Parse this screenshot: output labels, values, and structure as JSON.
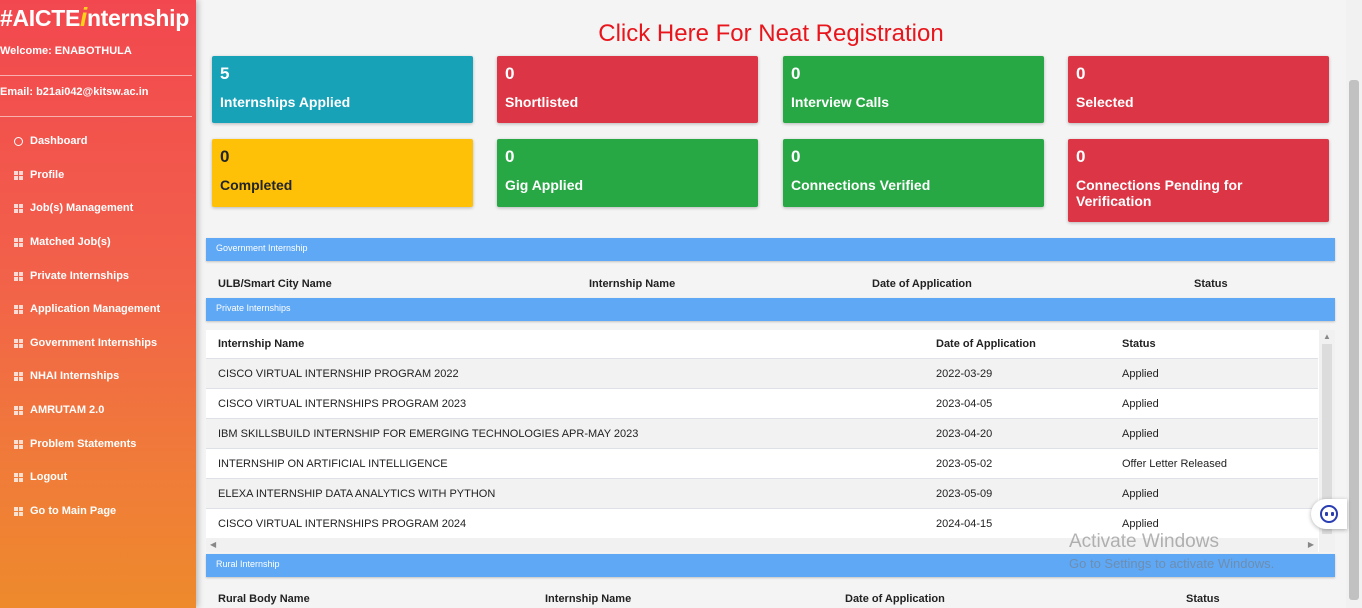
{
  "sidebar": {
    "logo_prefix": "#AICTE",
    "logo_i": "i",
    "logo_suffix": "nternship",
    "welcome": "Welcome: ENABOTHULA",
    "email": "Email: b21ai042@kitsw.ac.in",
    "items": [
      {
        "label": "Dashboard",
        "icon": "circle-icon"
      },
      {
        "label": "Profile",
        "icon": "grid-icon"
      },
      {
        "label": "Job(s) Management",
        "icon": "grid-icon"
      },
      {
        "label": "Matched Job(s)",
        "icon": "grid-icon"
      },
      {
        "label": "Private Internships",
        "icon": "grid-icon"
      },
      {
        "label": "Application Management",
        "icon": "grid-icon"
      },
      {
        "label": "Government Internships",
        "icon": "grid-icon"
      },
      {
        "label": "NHAI Internships",
        "icon": "grid-icon"
      },
      {
        "label": "AMRUTAM 2.0",
        "icon": "grid-icon"
      },
      {
        "label": "Problem Statements",
        "icon": "grid-icon"
      },
      {
        "label": "Logout",
        "icon": "grid-icon"
      },
      {
        "label": "Go to Main Page",
        "icon": "grid-icon"
      }
    ]
  },
  "header": {
    "neat_link": "Click Here For Neat Registration"
  },
  "cards": [
    {
      "value": "5",
      "label": "Internships Applied",
      "color": "#17a2b8"
    },
    {
      "value": "0",
      "label": "Shortlisted",
      "color": "#dc3545"
    },
    {
      "value": "0",
      "label": "Interview Calls",
      "color": "#28a745"
    },
    {
      "value": "0",
      "label": "Selected",
      "color": "#dc3545"
    },
    {
      "value": "0",
      "label": "Completed",
      "color": "#ffc107"
    },
    {
      "value": "0",
      "label": "Gig Applied",
      "color": "#28a745"
    },
    {
      "value": "0",
      "label": "Connections Verified",
      "color": "#28a745"
    },
    {
      "value": "0",
      "label": "Connections Pending for Verification",
      "color": "#dc3545"
    }
  ],
  "government": {
    "title": "Government Internship",
    "columns": [
      "ULB/Smart City Name",
      "Internship Name",
      "Date of Application",
      "Status"
    ]
  },
  "private": {
    "title": "Private Internships",
    "columns": [
      "Internship Name",
      "Date of Application",
      "Status"
    ],
    "rows": [
      {
        "name": "CISCO VIRTUAL INTERNSHIP PROGRAM 2022",
        "date": "2022-03-29",
        "status": "Applied"
      },
      {
        "name": "CISCO VIRTUAL INTERNSHIPS PROGRAM 2023",
        "date": "2023-04-05",
        "status": "Applied"
      },
      {
        "name": "IBM SKILLSBUILD INTERNSHIP FOR EMERGING TECHNOLOGIES APR-MAY 2023",
        "date": "2023-04-20",
        "status": "Applied"
      },
      {
        "name": "INTERNSHIP ON ARTIFICIAL INTELLIGENCE",
        "date": "2023-05-02",
        "status": "Offer Letter Released"
      },
      {
        "name": "ELEXA INTERNSHIP DATA ANALYTICS WITH PYTHON",
        "date": "2023-05-09",
        "status": "Applied"
      },
      {
        "name": "CISCO VIRTUAL INTERNSHIPS PROGRAM 2024",
        "date": "2024-04-15",
        "status": "Applied"
      }
    ]
  },
  "rural": {
    "title": "Rural Internship",
    "columns": [
      "Rural Body Name",
      "Internship Name",
      "Date of Application",
      "Status"
    ]
  },
  "watermark": {
    "line1": "Activate Windows",
    "line2": "Go to Settings to activate Windows."
  },
  "chat_widget": {
    "icon": "chatbot-icon"
  }
}
